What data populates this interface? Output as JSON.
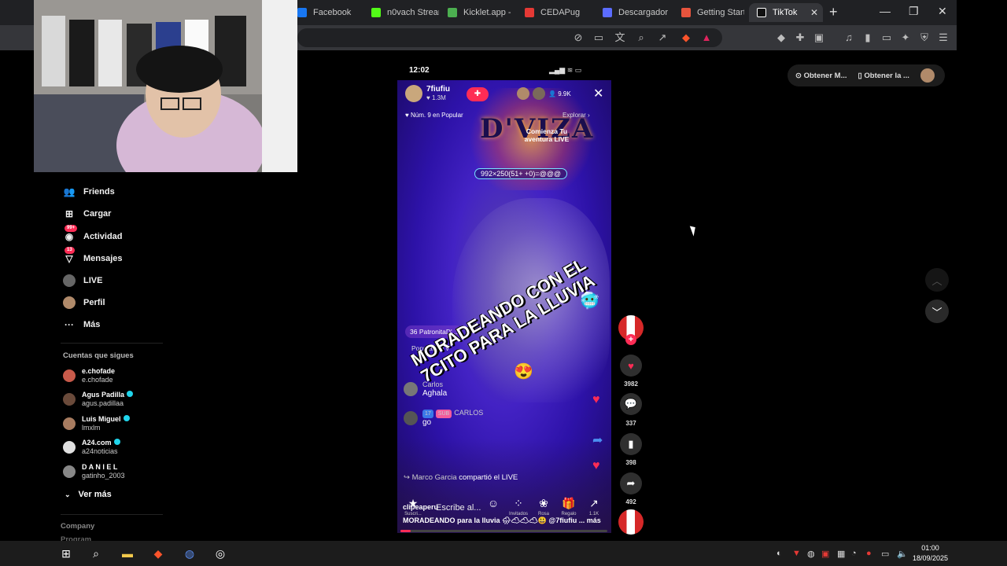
{
  "browser": {
    "tabs": [
      {
        "label": "Facebook",
        "color": "#1877f2"
      },
      {
        "label": "n0vach Stream",
        "color": "#53fc18"
      },
      {
        "label": "Kicklet.app -",
        "color": "#4caf50"
      },
      {
        "label": "CEDAPug",
        "color": "#e53935"
      },
      {
        "label": "Descargador",
        "color": "#5b6cff"
      },
      {
        "label": "Getting Starte",
        "color": "#e8543d"
      },
      {
        "label": "TikTok",
        "color": "#ffffff"
      }
    ],
    "new_tab": "+",
    "window_controls": [
      "—",
      "❐",
      "✕"
    ]
  },
  "page": {
    "header_pills": [
      "Obtener M...",
      "Obtener la ..."
    ]
  },
  "sidebar": {
    "nav": [
      {
        "label": "Friends",
        "icon": "👥",
        "icon_name": "friends-icon",
        "badge": ""
      },
      {
        "label": "Cargar",
        "icon": "⊞",
        "icon_name": "upload-icon",
        "badge": ""
      },
      {
        "label": "Actividad",
        "icon": "◉",
        "icon_name": "activity-icon",
        "badge": "99+"
      },
      {
        "label": "Mensajes",
        "icon": "▽",
        "icon_name": "messages-icon",
        "badge": "13"
      },
      {
        "label": "LIVE",
        "icon": "●",
        "icon_name": "live-icon",
        "badge": ""
      },
      {
        "label": "Perfil",
        "icon": "●",
        "icon_name": "profile-icon",
        "badge": ""
      },
      {
        "label": "Más",
        "icon": "···",
        "icon_name": "more-icon",
        "badge": ""
      }
    ],
    "following_title": "Cuentas que sigues",
    "following": [
      {
        "name": "e.chofade",
        "handle": "e.chofade",
        "verified": false,
        "color": "#c85a4a"
      },
      {
        "name": "Agus Padilla",
        "handle": "agus.padillaa",
        "verified": true,
        "color": "#6a4a3a"
      },
      {
        "name": "Luis Miguel",
        "handle": "lmxlm",
        "verified": true,
        "color": "#a87c60"
      },
      {
        "name": "A24.com",
        "handle": "a24noticias",
        "verified": true,
        "color": "#e0e0e0"
      },
      {
        "name": "D A N I E L",
        "handle": "gatinho_2003",
        "verified": false,
        "color": "#888888"
      }
    ],
    "see_more": "Ver más",
    "footer": [
      "Company",
      "Program"
    ]
  },
  "phone": {
    "time": "12:02",
    "live": {
      "host_name": "7fiufiu",
      "host_likes": "1.3M",
      "viewers": "9.9K",
      "rank": "Núm. 9 en Popular",
      "explore": "Explorar",
      "promo": "Comienza Tu aventura LIVE",
      "brand_text": "D'VIZA",
      "formula": "992×250(51+ +0)=@@@",
      "overlay_text": "MORADEANDO CON EL 7CITO PARA LA LLUVIA",
      "gift_row": "36 PatronitaD'...",
      "popular_label": "Popular no v",
      "comments": [
        {
          "user": "Carlos",
          "text": "Aghala",
          "level": "",
          "sub": ""
        },
        {
          "user": "CARLOS",
          "text": "go",
          "level": "17",
          "sub": "SUB"
        }
      ],
      "share_user": "Marco Garcia",
      "share_text": "compartió el LIVE",
      "input_placeholder": "Escribe al...",
      "bottom_labels": [
        "Suscri...",
        "Invitados",
        "Rosa",
        "Regalo",
        "1.1K"
      ]
    },
    "caption_user": "clipeaperu",
    "caption": "MORADEANDO para la lluvia 🌧☁☁☁😃 @7fiufiu ... más",
    "progress": 0.05
  },
  "rail": {
    "likes": "3982",
    "comments": "337",
    "saves": "398",
    "shares": "492"
  },
  "taskbar": {
    "time": "01:00",
    "date": "18/09/2025"
  }
}
